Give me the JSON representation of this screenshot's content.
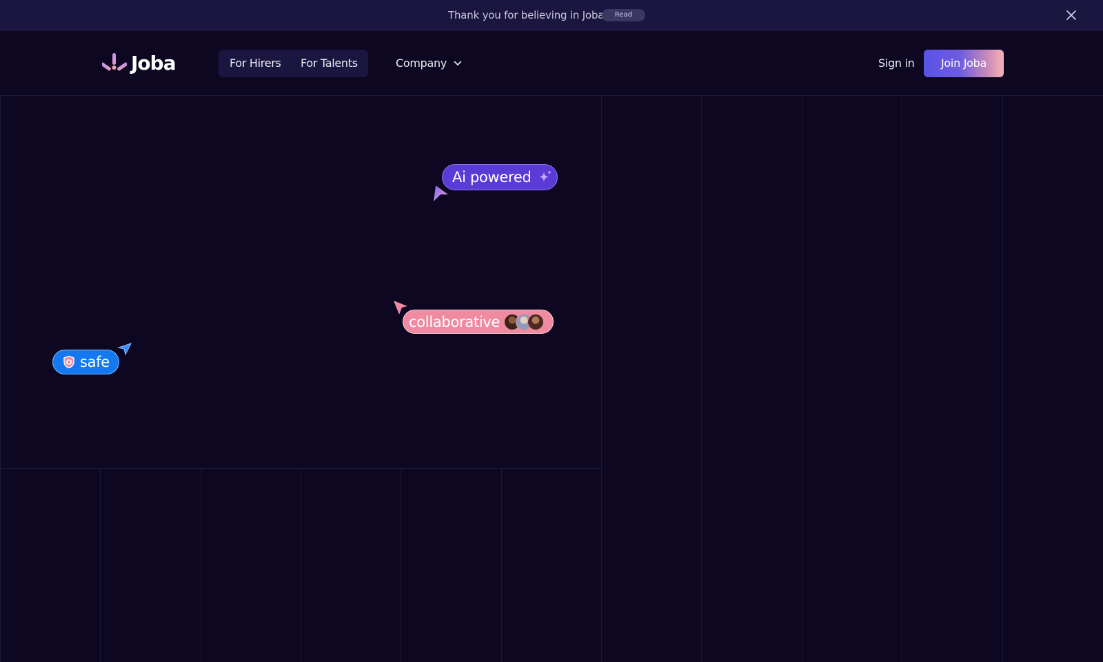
{
  "announcement": {
    "text": "Thank you for believing in Joba",
    "read_label": "Read"
  },
  "header": {
    "logo_text": "Joba",
    "nav": {
      "hirers_label": "For Hirers",
      "talents_label": "For Talents",
      "company_label": "Company"
    },
    "signin_label": "Sign in",
    "join_label": "Join Joba"
  },
  "badges": {
    "ai": "Ai powered",
    "collab": "collaborative",
    "safe": "safe"
  },
  "colors": {
    "background": "#0d0722",
    "announce_bg": "#1b1640",
    "ai_badge": "#5a3bd6",
    "collab_badge": "#f08aa0",
    "safe_badge": "#1479f0",
    "join_gradient_start": "#5a52e6",
    "join_gradient_end": "#f6b3b9"
  },
  "icons": {
    "close": "close-icon",
    "chevron": "chevron-down-icon",
    "sparkle": "sparkle-icon",
    "shield": "shield-icon",
    "cursor": "cursor-arrow-icon"
  }
}
